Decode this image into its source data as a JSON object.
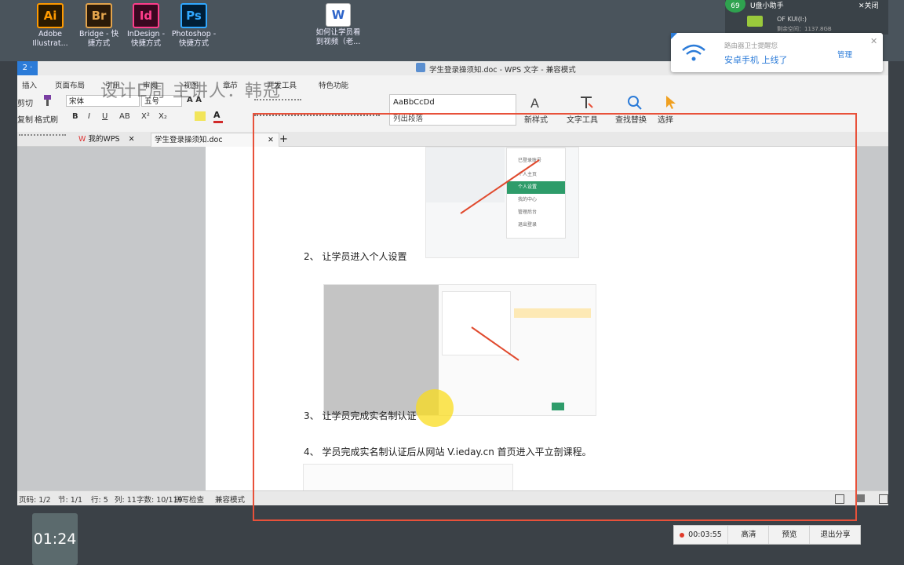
{
  "desktop": {
    "icons": [
      {
        "glyph": "Ai",
        "label1": "Adobe",
        "label2": "Illustrat...",
        "color": "#ff9a00",
        "bg": "#2b1a00"
      },
      {
        "glyph": "Br",
        "label1": "Bridge - 快",
        "label2": "捷方式",
        "color": "#e3a44c",
        "bg": "#2b1a08"
      },
      {
        "glyph": "Id",
        "label1": "InDesign -",
        "label2": "快捷方式",
        "color": "#ff3d8b",
        "bg": "#3a0820"
      },
      {
        "glyph": "Ps",
        "label1": "Photoshop -",
        "label2": "快捷方式",
        "color": "#31a8ff",
        "bg": "#001e36"
      }
    ],
    "doc_icon": {
      "glyph": "W",
      "label1": "如何让学员看",
      "label2": "到视频（老..."
    },
    "assistant": {
      "title": "U盘小助手",
      "close": "✕关闭",
      "badge": "69",
      "drive": "OF KUI(I:)",
      "drive_detail": "剩余空间：1137.8GB"
    }
  },
  "window": {
    "app_button": "2 ·",
    "title": "学生登录操须知.doc - WPS 文字 - 兼容模式",
    "menu": [
      "插入",
      "页面布局",
      "引用",
      "审阅",
      "视图",
      "章节",
      "开发工具",
      "特色功能"
    ],
    "clipboard": {
      "cut": "剪切",
      "copy": "复制",
      "format_painter": "格式刷"
    },
    "font": {
      "family": "宋体",
      "size": "五号"
    },
    "format_buttons": [
      "B",
      "I",
      "U",
      "AB",
      "X²",
      "X₂"
    ],
    "style_preview": "AaBbCcDd",
    "style_name": "列出段落",
    "big_buttons": [
      "新样式",
      "文字工具",
      "查找替换",
      "选择"
    ],
    "tabs": [
      {
        "label": "我的WPS",
        "close": "✕"
      },
      {
        "label": "学生登录操须知.doc",
        "close": "✕"
      }
    ],
    "new_tab": "+",
    "status": {
      "page": "页码: 1/2",
      "section": "节: 1/1",
      "row": "行: 5",
      "col": "列: 11",
      "chars": "字数: 10/119",
      "spell": "拼写检查",
      "mode": "兼容模式"
    }
  },
  "document": {
    "step2": "2、 让学员进入个人设置",
    "step3": "3、 让学员完成实名制认证",
    "step4": "4、 学员完成实名制认证后从网站 V.ieday.cn 首页进入平立剖课程。",
    "menu_shot_items": [
      "已登录账号",
      "个人主页",
      "个人设置",
      "我的中心",
      "管理后台",
      "退出登录"
    ]
  },
  "overlay": {
    "watermark": "设计E周  主讲人：韩冠",
    "notification": {
      "line1": "路由器卫士提醒您",
      "line2": "安卓手机 上线了",
      "action": "管理",
      "close": "✕"
    },
    "timer": "01:24",
    "recording": {
      "time": "00:03:55",
      "quality": "高清",
      "preview": "预览",
      "exit": "退出分享"
    }
  },
  "colors": {
    "accent": "#2b7bd8",
    "record_frame": "#e8513a",
    "menu_green": "#2e9c6a"
  }
}
